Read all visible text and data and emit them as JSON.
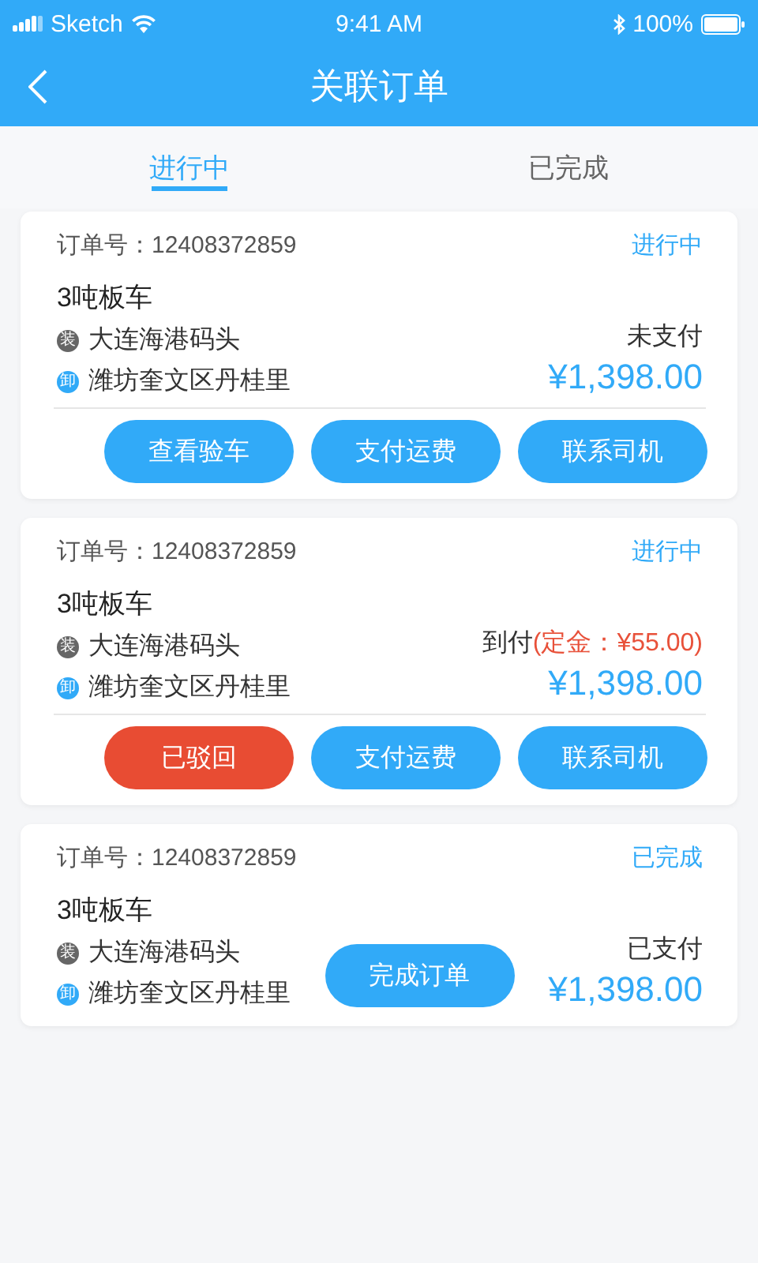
{
  "status_bar": {
    "carrier": "Sketch",
    "time": "9:41 AM",
    "battery": "100%"
  },
  "nav": {
    "title": "关联订单"
  },
  "tabs": [
    {
      "label": "进行中",
      "selected": true
    },
    {
      "label": "已完成",
      "selected": false
    }
  ],
  "orders": [
    {
      "kind": "full",
      "order_no": "订单号：12408372859",
      "status": "进行中",
      "vehicle": "3吨板车",
      "load_badge": "装",
      "load": "大连海港码头",
      "unload_badge": "卸",
      "unload": "潍坊奎文区丹桂里",
      "payment": "未支付",
      "price": "¥1,398.00",
      "buttons": [
        {
          "label": "查看验车",
          "kind": "primary"
        },
        {
          "label": "支付运费",
          "kind": "primary"
        },
        {
          "label": "联系司机",
          "kind": "primary"
        }
      ]
    },
    {
      "kind": "full",
      "order_no": "订单号：12408372859",
      "status": "进行中",
      "vehicle": "3吨板车",
      "load_badge": "装",
      "load": "大连海港码头",
      "unload_badge": "卸",
      "unload": "潍坊奎文区丹桂里",
      "payment": "到付",
      "deposit": "(定金：¥55.00)",
      "price": "¥1,398.00",
      "buttons": [
        {
          "label": "已驳回",
          "kind": "danger"
        },
        {
          "label": "支付运费",
          "kind": "primary"
        },
        {
          "label": "联系司机",
          "kind": "primary"
        }
      ]
    },
    {
      "kind": "compact",
      "order_no": "订单号：12408372859",
      "status": "已完成",
      "vehicle": "3吨板车",
      "load_badge": "装",
      "load": "大连海港码头",
      "unload_badge": "卸",
      "unload": "潍坊奎文区丹桂里",
      "payment": "已支付",
      "price": "¥1,398.00",
      "buttons": [
        {
          "label": "完成订单",
          "kind": "primary"
        }
      ]
    }
  ]
}
